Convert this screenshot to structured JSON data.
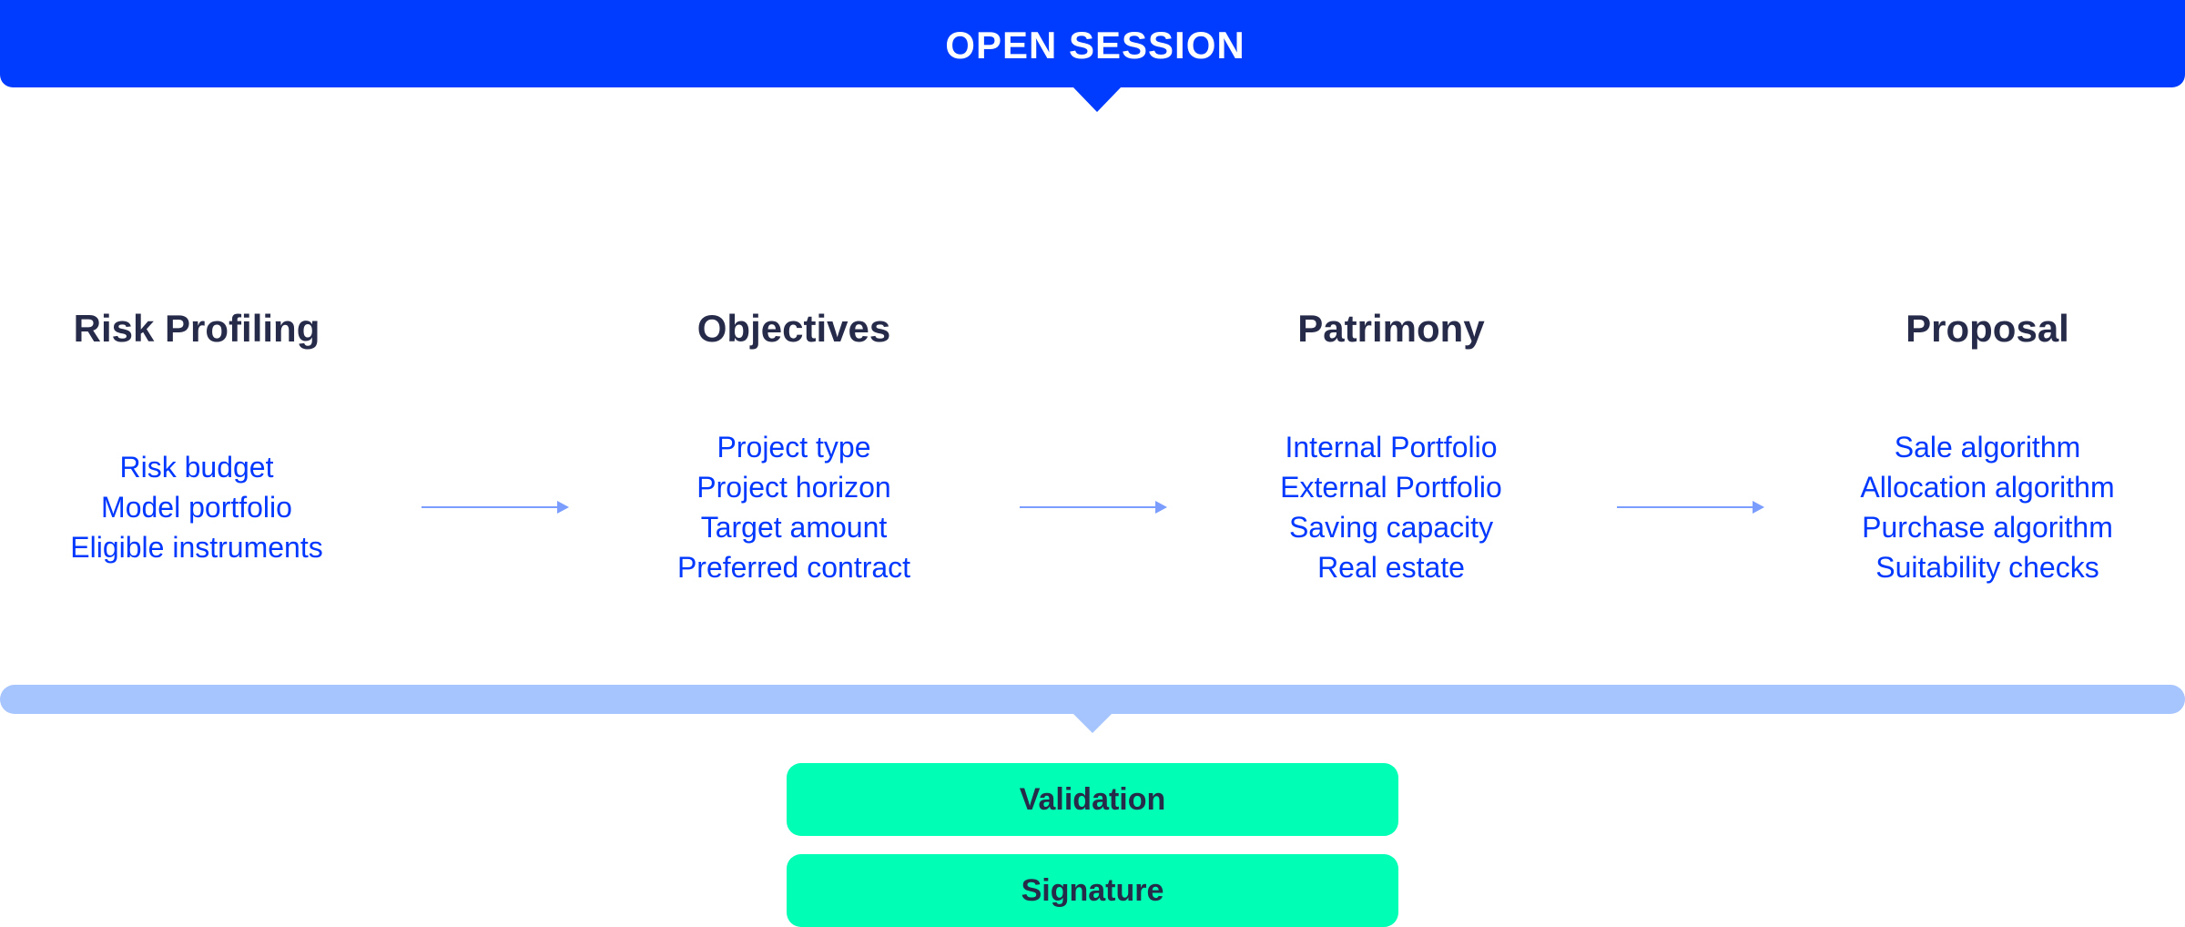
{
  "header": {
    "title": "OPEN SESSION"
  },
  "steps": [
    {
      "title": "Risk Profiling",
      "items": [
        "Risk budget",
        "Model portfolio",
        "Eligible instruments"
      ]
    },
    {
      "title": "Objectives",
      "items": [
        "Project type",
        "Project horizon",
        "Target amount",
        "Preferred contract"
      ]
    },
    {
      "title": "Patrimony",
      "items": [
        "Internal Portfolio",
        "External Portfolio",
        "Saving capacity",
        "Real estate"
      ]
    },
    {
      "title": "Proposal",
      "items": [
        "Sale algorithm",
        "Allocation algorithm",
        "Purchase algorithm",
        "Suitability checks"
      ]
    }
  ],
  "actions": {
    "validation_label": "Validation",
    "signature_label": "Signature"
  },
  "colors": {
    "banner": "#003cff",
    "heading_text": "#272b4a",
    "item_text": "#0038ff",
    "arrow": "#7a9dff",
    "progress_bar": "#a6c4fd",
    "action_button": "#00ffb4"
  }
}
